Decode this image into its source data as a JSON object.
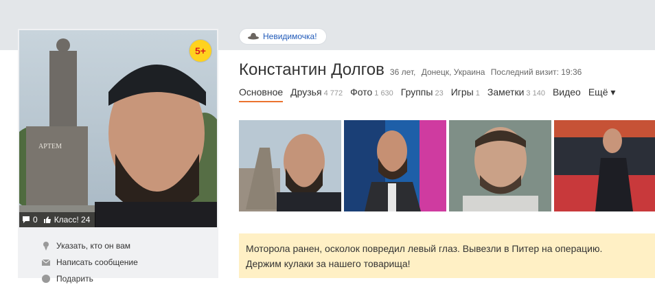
{
  "status_pill": {
    "icon": "hat-icon",
    "label": "Невидимочка!"
  },
  "profile": {
    "name": "Константин Долгов",
    "age": "36 лет,",
    "location": "Донецк, Украина",
    "last_visit": "Последний визит: 19:36"
  },
  "avatar": {
    "badge": "5+",
    "comments": "0",
    "likes": "Класс! 24",
    "monument_text": "АРТЕМ"
  },
  "sidebar_menu": [
    {
      "icon": "user-icon",
      "label": "Указать, кто он вам"
    },
    {
      "icon": "envelope-icon",
      "label": "Написать сообщение"
    },
    {
      "icon": "gift-icon",
      "label": "Подарить"
    }
  ],
  "tabs": [
    {
      "label": "Основное",
      "count": "",
      "active": true
    },
    {
      "label": "Друзья",
      "count": "4 772"
    },
    {
      "label": "Фото",
      "count": "1 630"
    },
    {
      "label": "Группы",
      "count": "23"
    },
    {
      "label": "Игры",
      "count": "1"
    },
    {
      "label": "Заметки",
      "count": "3 140"
    },
    {
      "label": "Видео",
      "count": ""
    },
    {
      "label": "Ещё ▾",
      "count": ""
    }
  ],
  "note": {
    "line1": "Моторола ранен, осколок повредил левый глаз. Вывезли в Питер на операцию.",
    "line2": "Держим кулаки за нашего товарища!"
  },
  "colors": {
    "accent": "#eb722e",
    "link": "#1f59b8",
    "note_bg": "#fff0c5",
    "topbar": "#e3e6e9"
  }
}
